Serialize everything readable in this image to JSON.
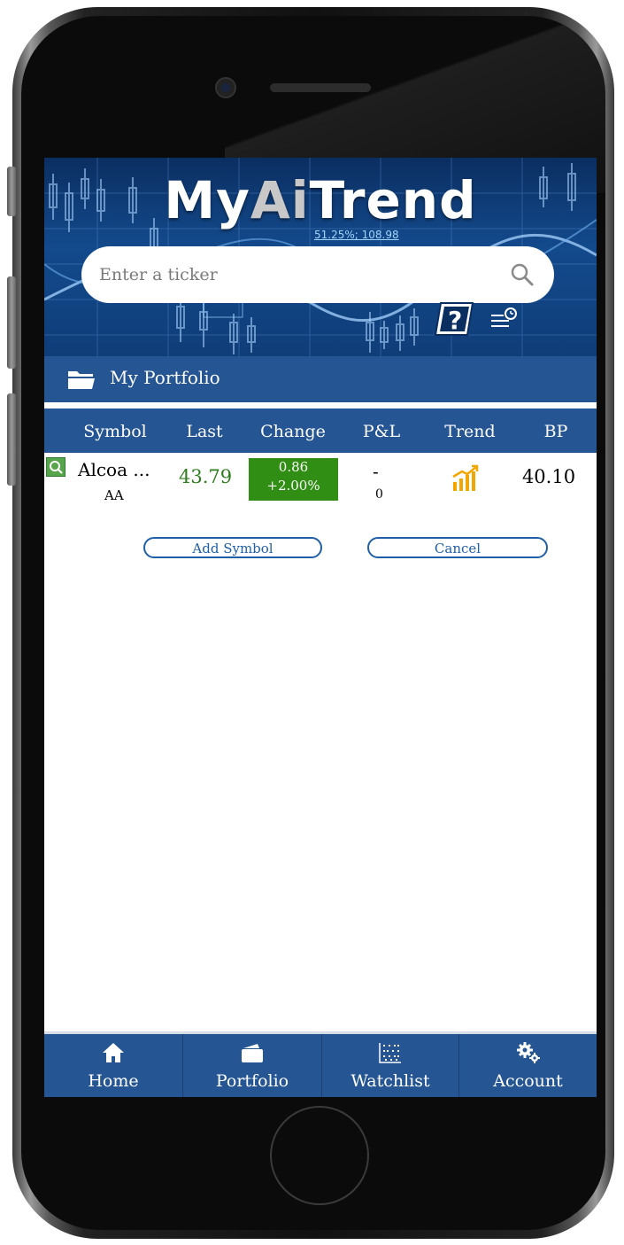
{
  "app": {
    "logo_text_1": "My",
    "logo_text_2": "Ai",
    "logo_text_3": "Trend",
    "banner_overlay_text": "51.25%; 108.98"
  },
  "search": {
    "placeholder": "Enter a ticker"
  },
  "portfolio": {
    "title": "My Portfolio"
  },
  "table": {
    "columns": [
      "Symbol",
      "Last",
      "Change",
      "P&L",
      "Trend",
      "BP"
    ],
    "rows": [
      {
        "name": "Alcoa ...",
        "symbol": "AA",
        "last": "43.79",
        "change": "0.86",
        "change_pct": "+2.00%",
        "pl_top": "-",
        "pl_bottom": "0",
        "trend_icon": "trend-up-bars-icon",
        "bp": "40.10"
      }
    ]
  },
  "actions": {
    "add_symbol": "Add Symbol",
    "cancel": "Cancel"
  },
  "nav": {
    "items": [
      {
        "label": "Home",
        "icon": "home-icon"
      },
      {
        "label": "Portfolio",
        "icon": "wallet-icon"
      },
      {
        "label": "Watchlist",
        "icon": "dots-grid-icon"
      },
      {
        "label": "Account",
        "icon": "gears-icon"
      }
    ]
  },
  "colors": {
    "primary_blue": "#255593",
    "change_green": "#2f8e13",
    "last_green": "#2e7d1e",
    "trend_gold": "#f2a600",
    "button_blue": "#1f5fa8"
  }
}
